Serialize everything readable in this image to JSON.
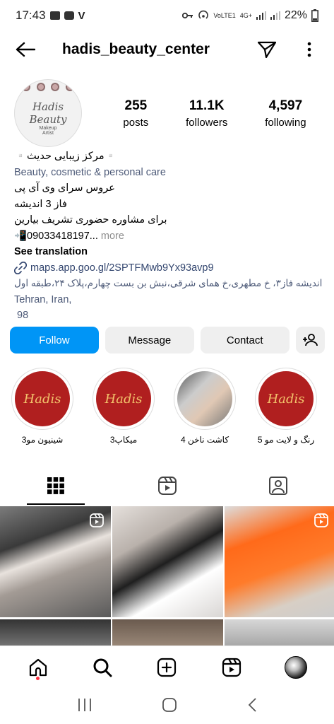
{
  "status_bar": {
    "time": "17:43",
    "battery": "22%",
    "network_top": "VoLTE1",
    "network_gen": "4G+"
  },
  "top_bar": {
    "username": "hadis_beauty_center",
    "icons": [
      "back-arrow-icon",
      "send-icon",
      "more-vertical-icon"
    ]
  },
  "profile": {
    "avatar_logo_line1": "Hadis",
    "avatar_logo_line2": "Beauty",
    "avatar_logo_sub1": "Makeup",
    "avatar_logo_sub2": "Artist",
    "stats": [
      {
        "value": "255",
        "label": "posts"
      },
      {
        "value": "11.1K",
        "label": "followers"
      },
      {
        "value": "4,597",
        "label": "following"
      }
    ]
  },
  "bio": {
    "name": "▫️مرکز زیبایی حدیث▫️",
    "category": "Beauty, cosmetic & personal care",
    "line1": "عروس سرای وی آی پی",
    "line2": "فاز 3 اندیشه",
    "line3": "برای مشاوره حضوری تشریف بیارین",
    "phone": "📲09033418197...",
    "more": " more",
    "see_translation": "See translation",
    "link": "maps.app.goo.gl/2SPTFMwb9Yx93avp9",
    "address_line1": "اندیشه فاز۳، خ مطهری،خ همای شرقی،نبش بن بست چهارم،پلاک ۲۴،طبقه اول",
    "address_line2": "Tehran, Iran,",
    "address_line3": "98"
  },
  "actions": {
    "follow": "Follow",
    "message": "Message",
    "contact": "Contact"
  },
  "highlights": [
    {
      "label": "شینیون مو3",
      "cover": "Hadis"
    },
    {
      "label": "میکاپ3",
      "cover": "Hadis"
    },
    {
      "label": "کاشت ناخن 4",
      "cover": ""
    },
    {
      "label": "رنگ و لایت مو 5",
      "cover": "Hadis"
    }
  ],
  "tabs": [
    "grid-icon",
    "reels-icon",
    "tagged-icon"
  ],
  "colors": {
    "follow_blue": "#0095f6",
    "button_gray": "#efefef",
    "highlight_red": "#b01f1f",
    "link_blue": "#33466f"
  }
}
